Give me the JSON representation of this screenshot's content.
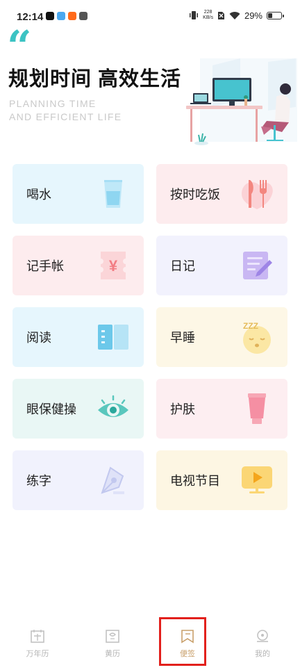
{
  "status_bar": {
    "time": "12:14",
    "net_speed_value": "228",
    "net_speed_unit": "KB/s",
    "battery": "29%",
    "battery_level": 0.29
  },
  "header": {
    "quote_mark": "“",
    "title": "规划时间 高效生活",
    "subtitle_line1": "PLANNING TIME",
    "subtitle_line2": "AND EFFICIENT LIFE"
  },
  "cards": [
    {
      "label": "喝水",
      "icon": "water-glass-icon",
      "bg": "#e6f6fd"
    },
    {
      "label": "按时吃饭",
      "icon": "fork-knife-icon",
      "bg": "#fdecee"
    },
    {
      "label": "记手帐",
      "icon": "yen-ticket-icon",
      "bg": "#fdecee"
    },
    {
      "label": "日记",
      "icon": "notepad-pencil-icon",
      "bg": "#f2f2fd"
    },
    {
      "label": "阅读",
      "icon": "open-book-icon",
      "bg": "#e6f6fd"
    },
    {
      "label": "早睡",
      "icon": "sleeping-face-icon",
      "bg": "#fdf7e6"
    },
    {
      "label": "眼保健操",
      "icon": "eye-icon",
      "bg": "#e9f7f5"
    },
    {
      "label": "护肤",
      "icon": "skincare-tube-icon",
      "bg": "#fdeef1"
    },
    {
      "label": "练字",
      "icon": "pen-nib-icon",
      "bg": "#f1f2fd"
    },
    {
      "label": "电视节目",
      "icon": "tv-play-icon",
      "bg": "#fdf6e3"
    }
  ],
  "bottom_nav": [
    {
      "label": "万年历",
      "icon": "calendar-icon"
    },
    {
      "label": "黄历",
      "icon": "almanac-icon"
    },
    {
      "label": "便签",
      "icon": "note-flag-icon"
    },
    {
      "label": "我的",
      "icon": "profile-icon"
    }
  ]
}
